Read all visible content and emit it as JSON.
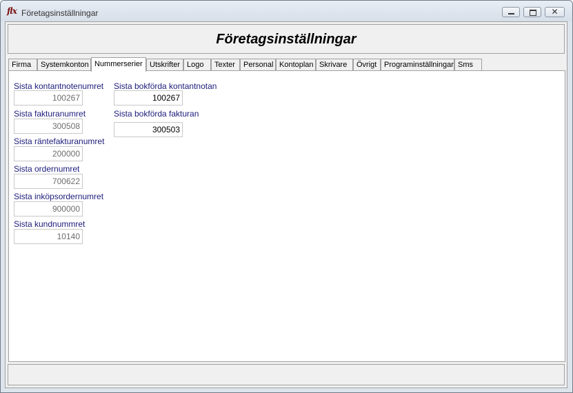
{
  "window": {
    "icon_text": "flx",
    "title": "Företagsinställningar",
    "controls": {
      "minimize": "minimize-icon",
      "maximize": "maximize-icon",
      "close": "✕"
    }
  },
  "header": {
    "title": "Företagsinställningar"
  },
  "tabs": [
    {
      "label": "Firma"
    },
    {
      "label": "Systemkonton"
    },
    {
      "label": "Nummerserier",
      "active": true
    },
    {
      "label": "Utskrifter"
    },
    {
      "label": "Logo"
    },
    {
      "label": "Texter"
    },
    {
      "label": "Personal"
    },
    {
      "label": "Kontoplan"
    },
    {
      "label": "Skrivare"
    },
    {
      "label": "Övrigt"
    },
    {
      "label": "Programinställningar"
    },
    {
      "label": "Sms"
    }
  ],
  "left_fields": [
    {
      "label": "Sista kontantnotenumret",
      "value": "100267"
    },
    {
      "label": "Sista fakturanumret",
      "value": "300508"
    },
    {
      "label": "Sista räntefakturanumret",
      "value": "200000"
    },
    {
      "label": "Sista ordernumret",
      "value": "700622"
    },
    {
      "label": "Sista inköpsordernumret",
      "value": "900000"
    },
    {
      "label": "Sista kundnummret",
      "value": "10140"
    }
  ],
  "right_fields": [
    {
      "label": "Sista bokförda kontantnotan",
      "value": "100267"
    },
    {
      "label": "Sista bokförda fakturan",
      "value": "300503"
    }
  ],
  "colors": {
    "label_text": "#1b1b7a",
    "disabled_value": "#6d6d6d"
  }
}
